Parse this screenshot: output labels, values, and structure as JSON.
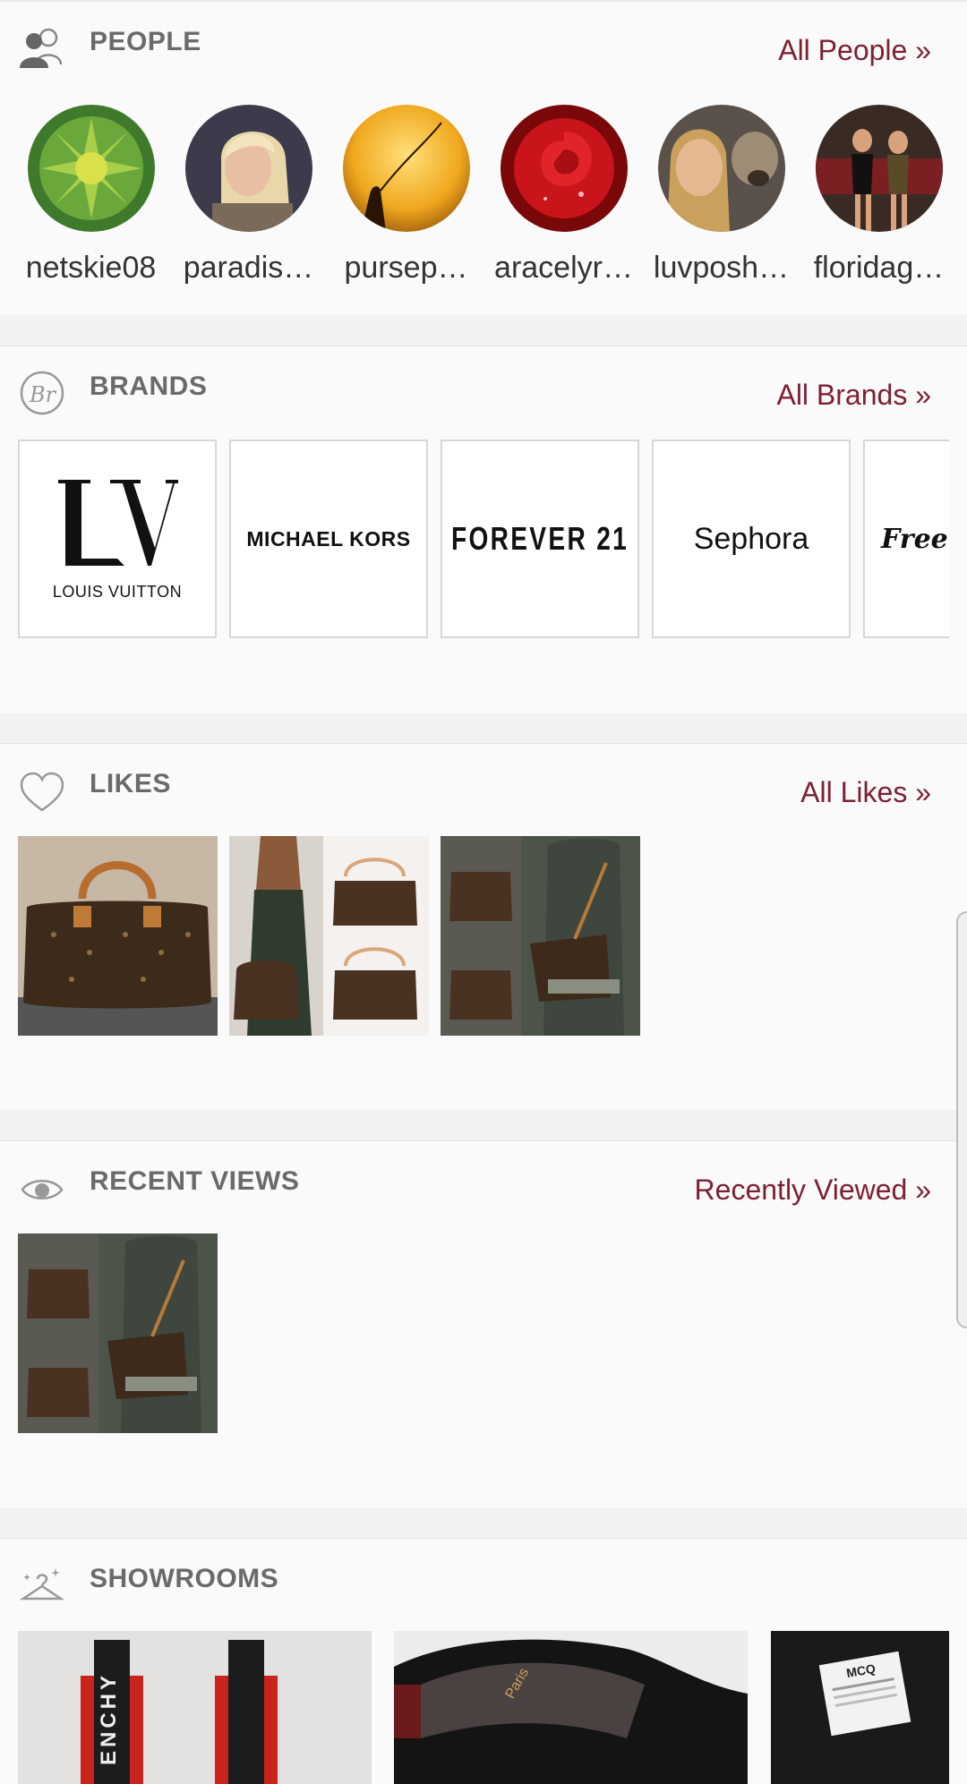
{
  "people": {
    "title": "PEOPLE",
    "link": "All People »",
    "users": [
      {
        "name": "netskie08"
      },
      {
        "name": "paradis…"
      },
      {
        "name": "pursep…"
      },
      {
        "name": "aracelyr…"
      },
      {
        "name": "luvposh…"
      },
      {
        "name": "floridag…"
      }
    ]
  },
  "brands": {
    "title": "BRANDS",
    "link": "All Brands »",
    "items": [
      {
        "name": "LOUIS VUITTON",
        "logo": "LV"
      },
      {
        "name": "MICHAEL KORS"
      },
      {
        "name": "FOREVER 21"
      },
      {
        "name": "Sephora"
      },
      {
        "name": "Free"
      }
    ]
  },
  "likes": {
    "title": "LIKES",
    "link": "All Likes »"
  },
  "recent": {
    "title": "RECENT VIEWS",
    "link": "Recently Viewed »"
  },
  "showrooms": {
    "title": "SHOWROOMS",
    "items": [
      {
        "label": "ENCHY"
      },
      {
        "label": "Paris"
      },
      {
        "label": "MCQ"
      }
    ]
  },
  "colors": {
    "accent": "#7d1f33",
    "section_title": "#6a6a6a",
    "background": "#fafafa"
  }
}
